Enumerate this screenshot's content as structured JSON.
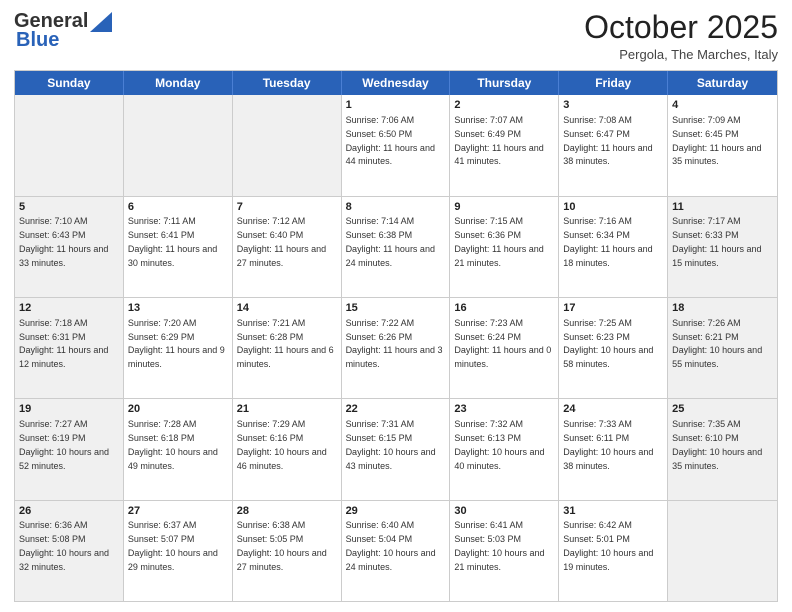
{
  "header": {
    "logo_general": "General",
    "logo_blue": "Blue",
    "month_title": "October 2025",
    "location": "Pergola, The Marches, Italy"
  },
  "weekdays": [
    "Sunday",
    "Monday",
    "Tuesday",
    "Wednesday",
    "Thursday",
    "Friday",
    "Saturday"
  ],
  "rows": [
    [
      {
        "day": "",
        "info": "",
        "shaded": true
      },
      {
        "day": "",
        "info": "",
        "shaded": true
      },
      {
        "day": "",
        "info": "",
        "shaded": true
      },
      {
        "day": "1",
        "info": "Sunrise: 7:06 AM\nSunset: 6:50 PM\nDaylight: 11 hours and 44 minutes.",
        "shaded": false
      },
      {
        "day": "2",
        "info": "Sunrise: 7:07 AM\nSunset: 6:49 PM\nDaylight: 11 hours and 41 minutes.",
        "shaded": false
      },
      {
        "day": "3",
        "info": "Sunrise: 7:08 AM\nSunset: 6:47 PM\nDaylight: 11 hours and 38 minutes.",
        "shaded": false
      },
      {
        "day": "4",
        "info": "Sunrise: 7:09 AM\nSunset: 6:45 PM\nDaylight: 11 hours and 35 minutes.",
        "shaded": false
      }
    ],
    [
      {
        "day": "5",
        "info": "Sunrise: 7:10 AM\nSunset: 6:43 PM\nDaylight: 11 hours and 33 minutes.",
        "shaded": true
      },
      {
        "day": "6",
        "info": "Sunrise: 7:11 AM\nSunset: 6:41 PM\nDaylight: 11 hours and 30 minutes.",
        "shaded": false
      },
      {
        "day": "7",
        "info": "Sunrise: 7:12 AM\nSunset: 6:40 PM\nDaylight: 11 hours and 27 minutes.",
        "shaded": false
      },
      {
        "day": "8",
        "info": "Sunrise: 7:14 AM\nSunset: 6:38 PM\nDaylight: 11 hours and 24 minutes.",
        "shaded": false
      },
      {
        "day": "9",
        "info": "Sunrise: 7:15 AM\nSunset: 6:36 PM\nDaylight: 11 hours and 21 minutes.",
        "shaded": false
      },
      {
        "day": "10",
        "info": "Sunrise: 7:16 AM\nSunset: 6:34 PM\nDaylight: 11 hours and 18 minutes.",
        "shaded": false
      },
      {
        "day": "11",
        "info": "Sunrise: 7:17 AM\nSunset: 6:33 PM\nDaylight: 11 hours and 15 minutes.",
        "shaded": true
      }
    ],
    [
      {
        "day": "12",
        "info": "Sunrise: 7:18 AM\nSunset: 6:31 PM\nDaylight: 11 hours and 12 minutes.",
        "shaded": true
      },
      {
        "day": "13",
        "info": "Sunrise: 7:20 AM\nSunset: 6:29 PM\nDaylight: 11 hours and 9 minutes.",
        "shaded": false
      },
      {
        "day": "14",
        "info": "Sunrise: 7:21 AM\nSunset: 6:28 PM\nDaylight: 11 hours and 6 minutes.",
        "shaded": false
      },
      {
        "day": "15",
        "info": "Sunrise: 7:22 AM\nSunset: 6:26 PM\nDaylight: 11 hours and 3 minutes.",
        "shaded": false
      },
      {
        "day": "16",
        "info": "Sunrise: 7:23 AM\nSunset: 6:24 PM\nDaylight: 11 hours and 0 minutes.",
        "shaded": false
      },
      {
        "day": "17",
        "info": "Sunrise: 7:25 AM\nSunset: 6:23 PM\nDaylight: 10 hours and 58 minutes.",
        "shaded": false
      },
      {
        "day": "18",
        "info": "Sunrise: 7:26 AM\nSunset: 6:21 PM\nDaylight: 10 hours and 55 minutes.",
        "shaded": true
      }
    ],
    [
      {
        "day": "19",
        "info": "Sunrise: 7:27 AM\nSunset: 6:19 PM\nDaylight: 10 hours and 52 minutes.",
        "shaded": true
      },
      {
        "day": "20",
        "info": "Sunrise: 7:28 AM\nSunset: 6:18 PM\nDaylight: 10 hours and 49 minutes.",
        "shaded": false
      },
      {
        "day": "21",
        "info": "Sunrise: 7:29 AM\nSunset: 6:16 PM\nDaylight: 10 hours and 46 minutes.",
        "shaded": false
      },
      {
        "day": "22",
        "info": "Sunrise: 7:31 AM\nSunset: 6:15 PM\nDaylight: 10 hours and 43 minutes.",
        "shaded": false
      },
      {
        "day": "23",
        "info": "Sunrise: 7:32 AM\nSunset: 6:13 PM\nDaylight: 10 hours and 40 minutes.",
        "shaded": false
      },
      {
        "day": "24",
        "info": "Sunrise: 7:33 AM\nSunset: 6:11 PM\nDaylight: 10 hours and 38 minutes.",
        "shaded": false
      },
      {
        "day": "25",
        "info": "Sunrise: 7:35 AM\nSunset: 6:10 PM\nDaylight: 10 hours and 35 minutes.",
        "shaded": true
      }
    ],
    [
      {
        "day": "26",
        "info": "Sunrise: 6:36 AM\nSunset: 5:08 PM\nDaylight: 10 hours and 32 minutes.",
        "shaded": true
      },
      {
        "day": "27",
        "info": "Sunrise: 6:37 AM\nSunset: 5:07 PM\nDaylight: 10 hours and 29 minutes.",
        "shaded": false
      },
      {
        "day": "28",
        "info": "Sunrise: 6:38 AM\nSunset: 5:05 PM\nDaylight: 10 hours and 27 minutes.",
        "shaded": false
      },
      {
        "day": "29",
        "info": "Sunrise: 6:40 AM\nSunset: 5:04 PM\nDaylight: 10 hours and 24 minutes.",
        "shaded": false
      },
      {
        "day": "30",
        "info": "Sunrise: 6:41 AM\nSunset: 5:03 PM\nDaylight: 10 hours and 21 minutes.",
        "shaded": false
      },
      {
        "day": "31",
        "info": "Sunrise: 6:42 AM\nSunset: 5:01 PM\nDaylight: 10 hours and 19 minutes.",
        "shaded": false
      },
      {
        "day": "",
        "info": "",
        "shaded": true
      }
    ]
  ]
}
